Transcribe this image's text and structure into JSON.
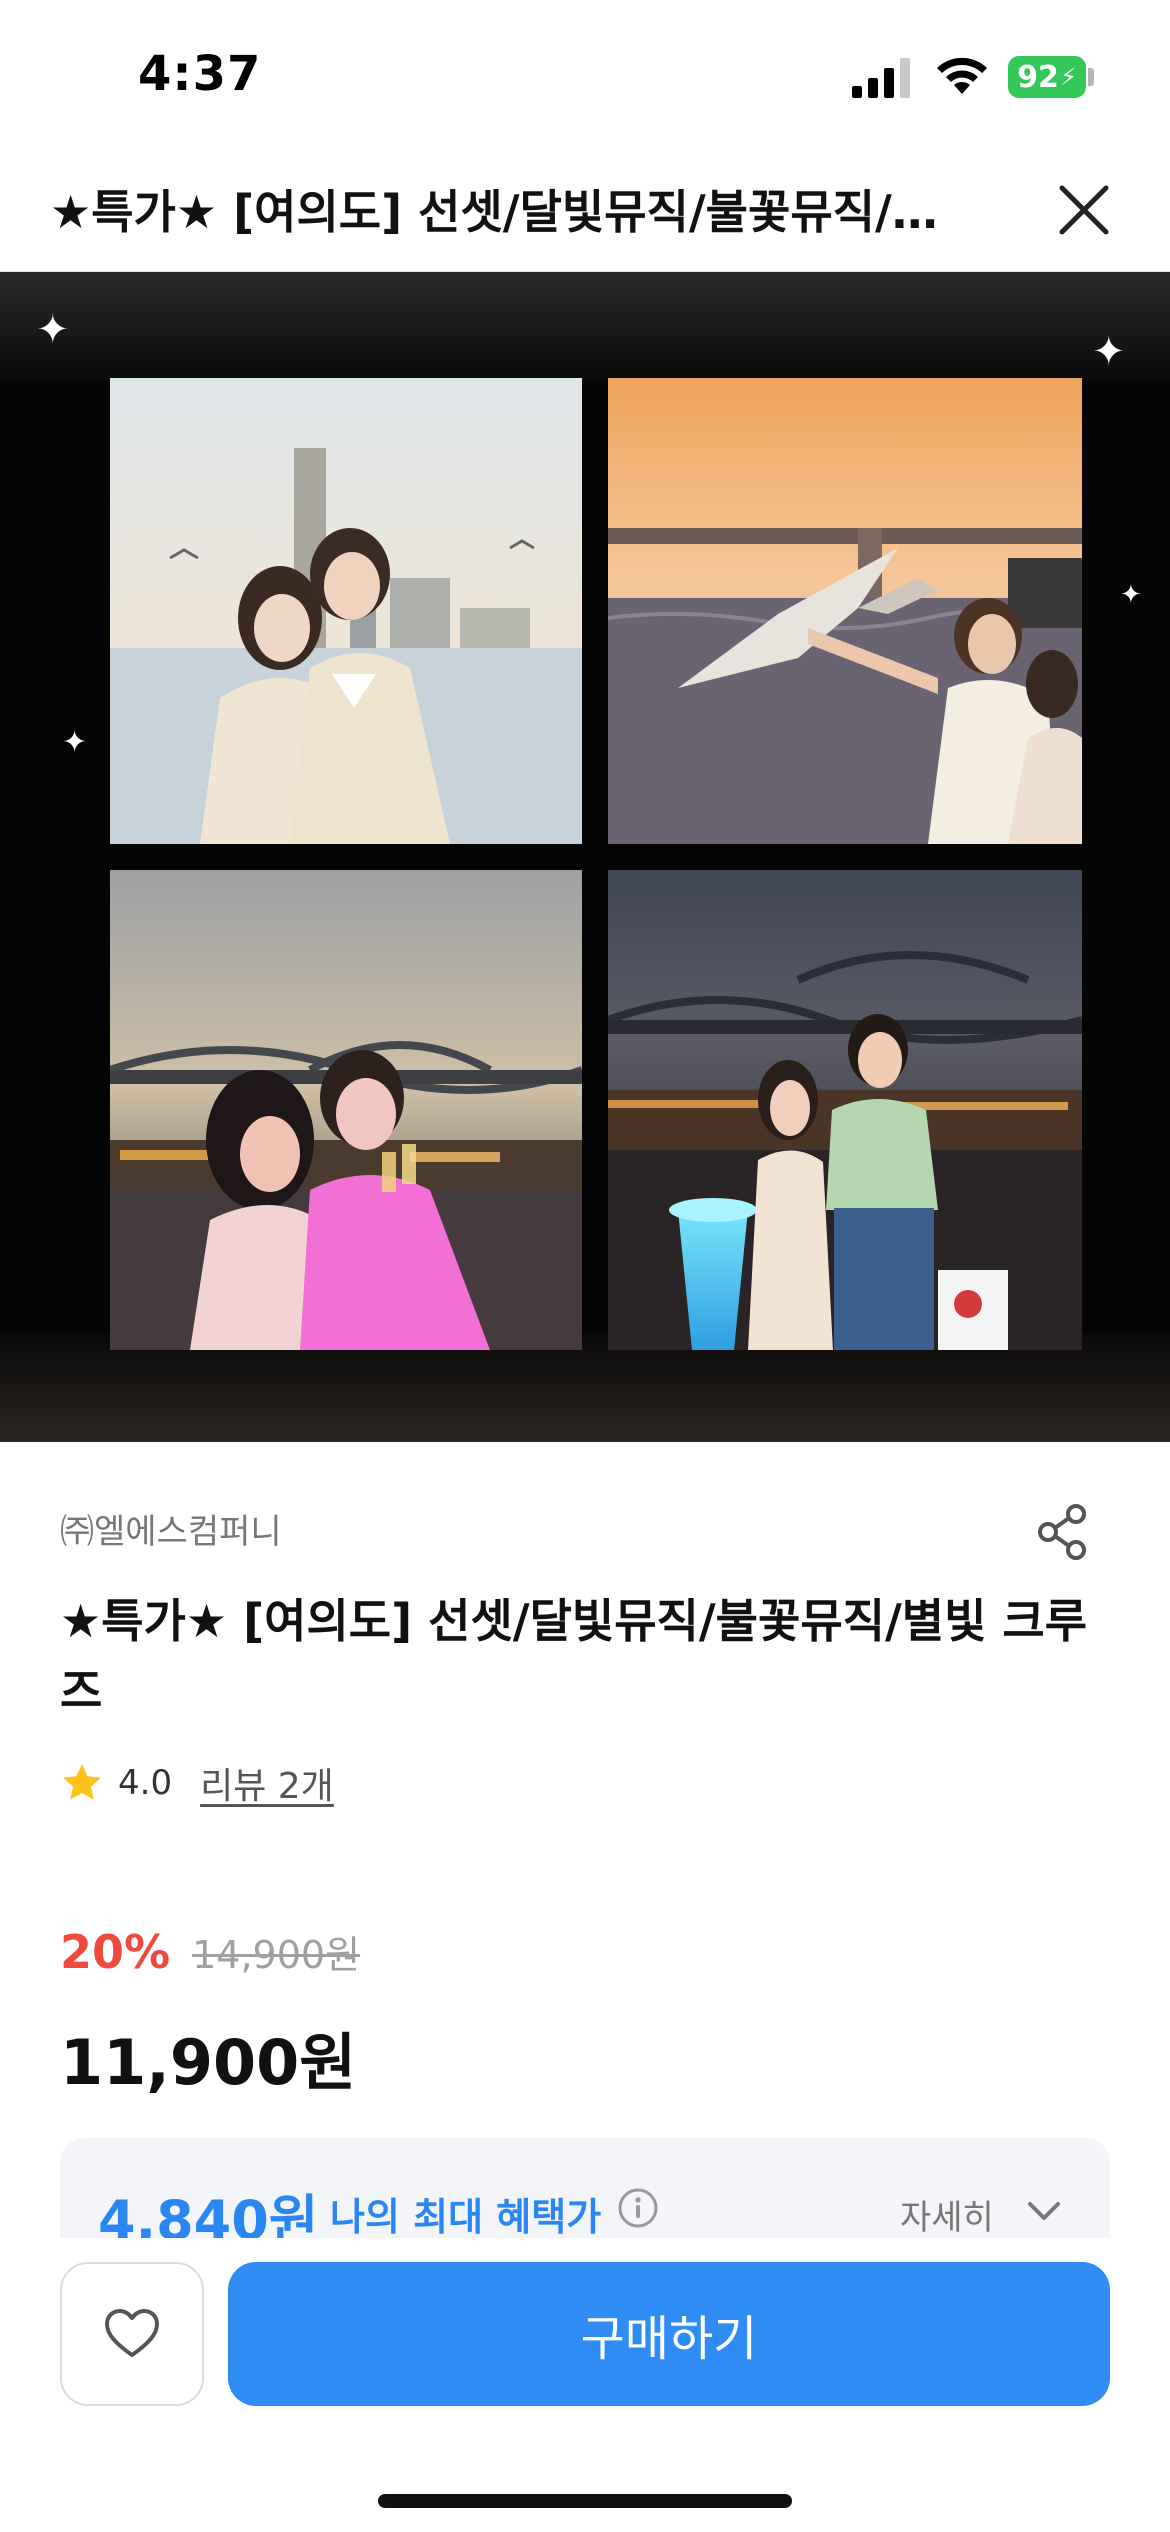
{
  "status_bar": {
    "time": "4:37",
    "battery": "92",
    "icons": [
      "signal-icon",
      "wifi-icon",
      "battery-icon"
    ]
  },
  "header": {
    "title": "★특가★ [여의도] 선셋/달빛뮤직/불꽃뮤직/별빛 크루즈",
    "close_icon": "close-icon"
  },
  "hero": {
    "photos": [
      {
        "subject": "couple at sunset by the river"
      },
      {
        "subject": "man feeding seagulls at golden hour"
      },
      {
        "subject": "couple toasting under pink light"
      },
      {
        "subject": "couple by glowing table at night"
      }
    ]
  },
  "product": {
    "seller": "㈜엘에스컴퍼니",
    "title": "★특가★ [여의도] 선셋/달빛뮤직/불꽃뮤직/별빛 크루즈",
    "rating": "4.0",
    "review_link": "리뷰 2개",
    "discount": "20%",
    "original_price": "14,900원",
    "sale_price": "11,900원"
  },
  "benefit": {
    "price": "4,840원",
    "label": "나의 최대 혜택가",
    "detail": "자세히"
  },
  "bottom_bar": {
    "buy_label": "구매하기",
    "wish_icon": "heart-icon"
  },
  "colors": {
    "accent_blue": "#2e8cf4",
    "benefit_blue": "#2a86f2",
    "discount_red": "#f04a3e",
    "star_yellow": "#ffc21a",
    "battery_green": "#34c759"
  }
}
